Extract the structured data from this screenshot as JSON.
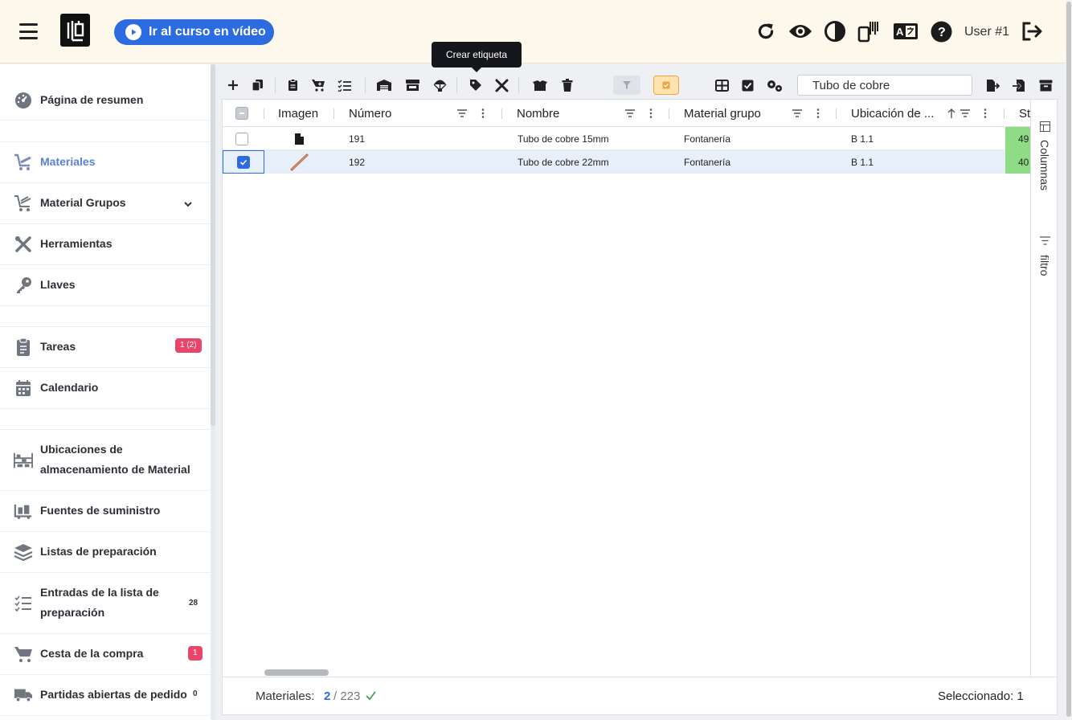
{
  "header": {
    "course_button": "Ir al curso en vídeo",
    "user": "User #1",
    "icons": [
      "refresh-icon",
      "eye-icon",
      "contrast-icon",
      "barcode-device-icon",
      "translate-icon",
      "help-icon",
      "logout-icon"
    ]
  },
  "sidebar": {
    "items": [
      {
        "label": "Página de resumen",
        "icon": "dashboard-icon"
      },
      {
        "label": "Materiales",
        "icon": "cart-icon",
        "active": true
      },
      {
        "label": "Material Grupos",
        "icon": "cart-group-icon"
      },
      {
        "label": "Herramientas",
        "icon": "tools-icon"
      },
      {
        "label": "Llaves",
        "icon": "key-icon"
      },
      {
        "label": "Tareas",
        "icon": "clipboard-icon",
        "badge": "1 (2)"
      },
      {
        "label": "Calendario",
        "icon": "calendar-icon"
      },
      {
        "label": "Ubicaciones de almacenamiento de Material",
        "icon": "warehouse-icon"
      },
      {
        "label": "Fuentes de suministro",
        "icon": "supply-icon"
      },
      {
        "label": "Listas de preparación",
        "icon": "layers-icon"
      },
      {
        "label": "Entradas de la lista de preparación",
        "icon": "checklist-icon",
        "count": "28"
      },
      {
        "label": "Cesta de la compra",
        "icon": "shopping-cart-icon",
        "badge": "1"
      },
      {
        "label": "Partidas abiertas de pedido",
        "icon": "truck-icon",
        "count": "0"
      }
    ]
  },
  "toolbar": {
    "tooltip": "Crear etiqueta",
    "search_value": "Tubo de cobre"
  },
  "grid": {
    "columns": [
      "Imagen",
      "Número",
      "Nombre",
      "Material grupo",
      "Ubicación de ...",
      "St"
    ],
    "rows": [
      {
        "numero": "191",
        "nombre": "Tubo de cobre 15mm",
        "grupo": "Fontanería",
        "ubicacion": "B 1.1",
        "stock": "49",
        "selected": false
      },
      {
        "numero": "192",
        "nombre": "Tubo de cobre 22mm",
        "grupo": "Fontanería",
        "ubicacion": "B 1.1",
        "stock": "40",
        "selected": true
      }
    ],
    "side_tabs": [
      "Columnas",
      "filtro"
    ]
  },
  "footer": {
    "label": "Materiales:",
    "shown": "2",
    "total": "/ 223",
    "selected_text": "Seleccionado: 1"
  },
  "colors": {
    "accent": "#2d6be0",
    "active_nav": "#5b7fd6",
    "badge": "#e8456b",
    "stock_green": "#8fdc86"
  }
}
